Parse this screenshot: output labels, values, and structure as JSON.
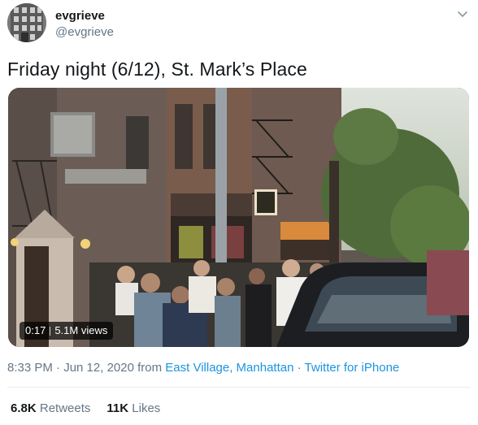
{
  "author": {
    "name": "evgrieve",
    "handle": "@evgrieve"
  },
  "tweet": {
    "text": "Friday night (6/12), St. Mark’s Place"
  },
  "video": {
    "time": "0:17",
    "views": "5.1M views"
  },
  "meta": {
    "datetime": "8:33 PM · Jun 12, 2020",
    "from_word": "from",
    "location": "East Village, Manhattan",
    "dot": "·",
    "source": "Twitter for iPhone"
  },
  "stats": {
    "retweets_count": "6.8K",
    "retweets_label": "Retweets",
    "likes_count": "11K",
    "likes_label": "Likes"
  },
  "icons": {
    "caret": "chevron-down-icon"
  },
  "colors": {
    "link": "#1b95e0",
    "secondary_text": "#657786",
    "primary_text": "#14171a",
    "divider": "#e6ecf0"
  }
}
